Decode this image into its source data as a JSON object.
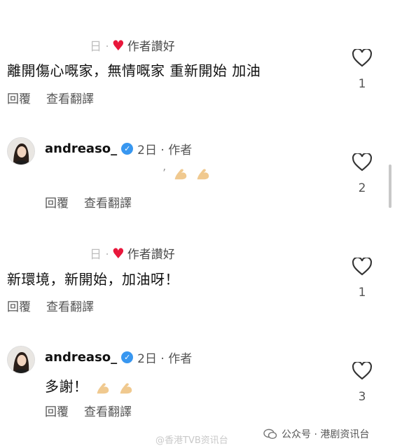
{
  "comments": [
    {
      "meta_prefix": "日 ·",
      "meta_label": "作者讚好",
      "text": "離開傷心嘅家，無情嘅家 重新開始 加油",
      "reply_label": "回覆",
      "translate_label": "查看翻譯",
      "likes": "1"
    },
    {
      "username": "andreaso_",
      "meta": "2日 · 作者",
      "text": "’",
      "reply_label": "回覆",
      "translate_label": "查看翻譯",
      "likes": "2"
    },
    {
      "meta_prefix": "日 ·",
      "meta_label": "作者讚好",
      "text": "新環境，新開始，加油呀！",
      "reply_label": "回覆",
      "translate_label": "查看翻譯",
      "likes": "1"
    },
    {
      "username": "andreaso_",
      "meta": "2日 · 作者",
      "text": "多謝！",
      "reply_label": "回覆",
      "translate_label": "查看翻譯",
      "likes": "3"
    }
  ],
  "footer": {
    "wechat_label": "公众号 · 港剧资讯台",
    "watermark": "@香港TVB资讯台"
  },
  "colors": {
    "heart": "#e8173b",
    "verified": "#3897f0"
  }
}
